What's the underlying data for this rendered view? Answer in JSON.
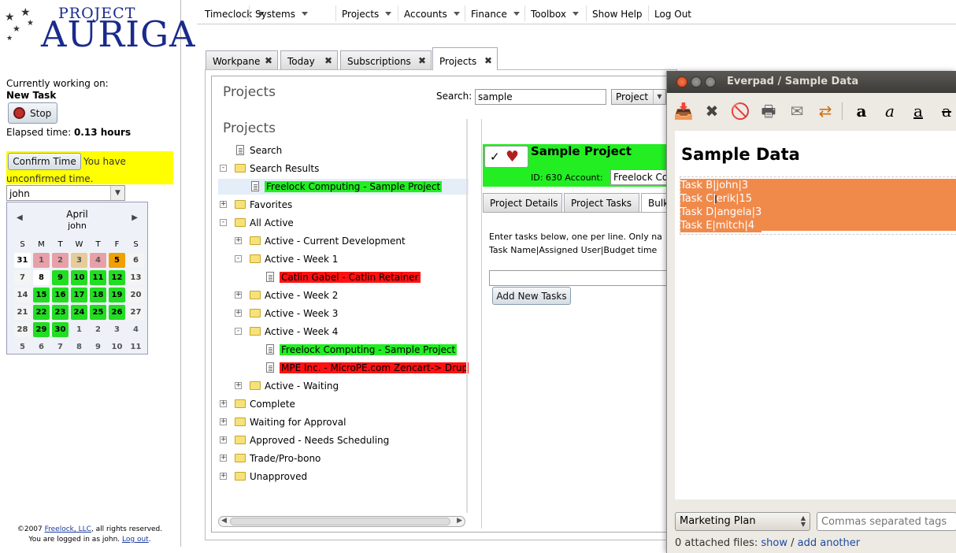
{
  "left": {
    "logo": {
      "top": "PROJECT",
      "main": "AURIGA"
    },
    "working_label": "Currently working on:",
    "task_name": "New Task",
    "stop_label": "Stop",
    "elapsed_label": "Elapsed time:",
    "elapsed_value": "0.13 hours",
    "confirm_label": "Confirm Time",
    "unconfirmed_msg_1": "You have",
    "unconfirmed_msg_2": "unconfirmed time.",
    "user_select": "john",
    "calendar": {
      "month": "April",
      "user": "john",
      "weekdays": [
        "S",
        "M",
        "T",
        "W",
        "T",
        "F",
        "S"
      ],
      "weeks": [
        [
          {
            "d": "31",
            "c": "wh"
          },
          {
            "d": "1",
            "c": "pk"
          },
          {
            "d": "2",
            "c": "pk"
          },
          {
            "d": "3",
            "c": "tn"
          },
          {
            "d": "4",
            "c": "pk"
          },
          {
            "d": "5",
            "c": "or"
          },
          {
            "d": "6",
            "c": "pl"
          }
        ],
        [
          {
            "d": "7",
            "c": "pl"
          },
          {
            "d": "8",
            "c": "wh"
          },
          {
            "d": "9",
            "c": "gr"
          },
          {
            "d": "10",
            "c": "gr"
          },
          {
            "d": "11",
            "c": "gr"
          },
          {
            "d": "12",
            "c": "gr"
          },
          {
            "d": "13",
            "c": "pl"
          }
        ],
        [
          {
            "d": "14",
            "c": "pl"
          },
          {
            "d": "15",
            "c": "gr"
          },
          {
            "d": "16",
            "c": "gr"
          },
          {
            "d": "17",
            "c": "gr"
          },
          {
            "d": "18",
            "c": "gr"
          },
          {
            "d": "19",
            "c": "gr"
          },
          {
            "d": "20",
            "c": "pl"
          }
        ],
        [
          {
            "d": "21",
            "c": "pl"
          },
          {
            "d": "22",
            "c": "gr"
          },
          {
            "d": "23",
            "c": "gr"
          },
          {
            "d": "24",
            "c": "gr"
          },
          {
            "d": "25",
            "c": "gr"
          },
          {
            "d": "26",
            "c": "gr"
          },
          {
            "d": "27",
            "c": "pl"
          }
        ],
        [
          {
            "d": "28",
            "c": "pl"
          },
          {
            "d": "29",
            "c": "gr"
          },
          {
            "d": "30",
            "c": "gr"
          },
          {
            "d": "1",
            "c": "out"
          },
          {
            "d": "2",
            "c": "out"
          },
          {
            "d": "3",
            "c": "out"
          },
          {
            "d": "4",
            "c": "out"
          }
        ],
        [
          {
            "d": "5",
            "c": "out"
          },
          {
            "d": "6",
            "c": "out"
          },
          {
            "d": "7",
            "c": "out"
          },
          {
            "d": "8",
            "c": "out"
          },
          {
            "d": "9",
            "c": "out"
          },
          {
            "d": "10",
            "c": "out"
          },
          {
            "d": "11",
            "c": "out"
          }
        ]
      ]
    },
    "footer_1a": "©2007 ",
    "footer_link": "Freelock, LLC",
    "footer_1b": ", all rights reserved.",
    "footer_2a": "You are logged in as john. ",
    "footer_logout": "Log out",
    "footer_2b": "."
  },
  "menu": [
    "Timeclock",
    "Systems",
    "Projects",
    "Accounts",
    "Finance",
    "Toolbox",
    "Show Help",
    "Log Out"
  ],
  "tabs": [
    "Workpane",
    "Today",
    "Subscriptions",
    "Projects"
  ],
  "projects": {
    "heading": "Projects",
    "search_label": "Search:",
    "search_value": "sample",
    "search_type": "Project",
    "tree_heading": "Projects",
    "tree": [
      {
        "label": "Search",
        "kind": "doc",
        "level": 0,
        "pm": ""
      },
      {
        "label": "Search Results",
        "kind": "fold",
        "level": 0,
        "pm": "-"
      },
      {
        "label": "Freelock Computing - Sample Project",
        "kind": "doc",
        "level": 1,
        "pm": "",
        "hl": "g",
        "sel": true
      },
      {
        "label": "Favorites",
        "kind": "fold",
        "level": 0,
        "pm": "+"
      },
      {
        "label": "All Active",
        "kind": "fold",
        "level": 0,
        "pm": "-"
      },
      {
        "label": "Active - Current Development",
        "kind": "fold",
        "level": 1,
        "pm": "+"
      },
      {
        "label": "Active - Week 1",
        "kind": "fold",
        "level": 1,
        "pm": "-"
      },
      {
        "label": "Catlin Gabel - Catlin Retainer",
        "kind": "doc",
        "level": 2,
        "pm": "",
        "hl": "r"
      },
      {
        "label": "Active - Week 2",
        "kind": "fold",
        "level": 1,
        "pm": "+"
      },
      {
        "label": "Active - Week 3",
        "kind": "fold",
        "level": 1,
        "pm": "+"
      },
      {
        "label": "Active - Week 4",
        "kind": "fold",
        "level": 1,
        "pm": "-"
      },
      {
        "label": "Freelock Computing - Sample Project",
        "kind": "doc",
        "level": 2,
        "pm": "",
        "hl": "g"
      },
      {
        "label": "MPE Inc. - MicroPE.com Zencart-> Drup",
        "kind": "doc",
        "level": 2,
        "pm": "",
        "hl": "r"
      },
      {
        "label": "Active - Waiting",
        "kind": "fold",
        "level": 1,
        "pm": "+"
      },
      {
        "label": "Complete",
        "kind": "fold",
        "level": 0,
        "pm": "+"
      },
      {
        "label": "Waiting for Approval",
        "kind": "fold",
        "level": 0,
        "pm": "+"
      },
      {
        "label": "Approved - Needs Scheduling",
        "kind": "fold",
        "level": 0,
        "pm": "+"
      },
      {
        "label": "Trade/Pro-bono",
        "kind": "fold",
        "level": 0,
        "pm": "+"
      },
      {
        "label": "Unapproved",
        "kind": "fold",
        "level": 0,
        "pm": "+"
      }
    ],
    "detail": {
      "title": "Sample Project",
      "id_label": "ID: 630 Account:",
      "account_value": "Freelock Co",
      "tabs": [
        "Project Details",
        "Project Tasks",
        "Bulk"
      ],
      "instructions_1": "Enter tasks below, one per line. Only na",
      "instructions_2": "Task Name|Assigned User|Budget time",
      "add_button": "Add New Tasks"
    }
  },
  "everpad": {
    "title": "Everpad / Sample Data",
    "note_title": "Sample Data",
    "lines": [
      "Task B|john|3",
      "Task C|erik|15",
      "Task D|angela|3",
      "Task E|mitch|4"
    ],
    "notebook": "Marketing Plan",
    "tags_placeholder": "Commas separated tags",
    "attached_text": "0 attached files:",
    "show_link": "show",
    "sep": " / ",
    "add_link": "add another"
  }
}
